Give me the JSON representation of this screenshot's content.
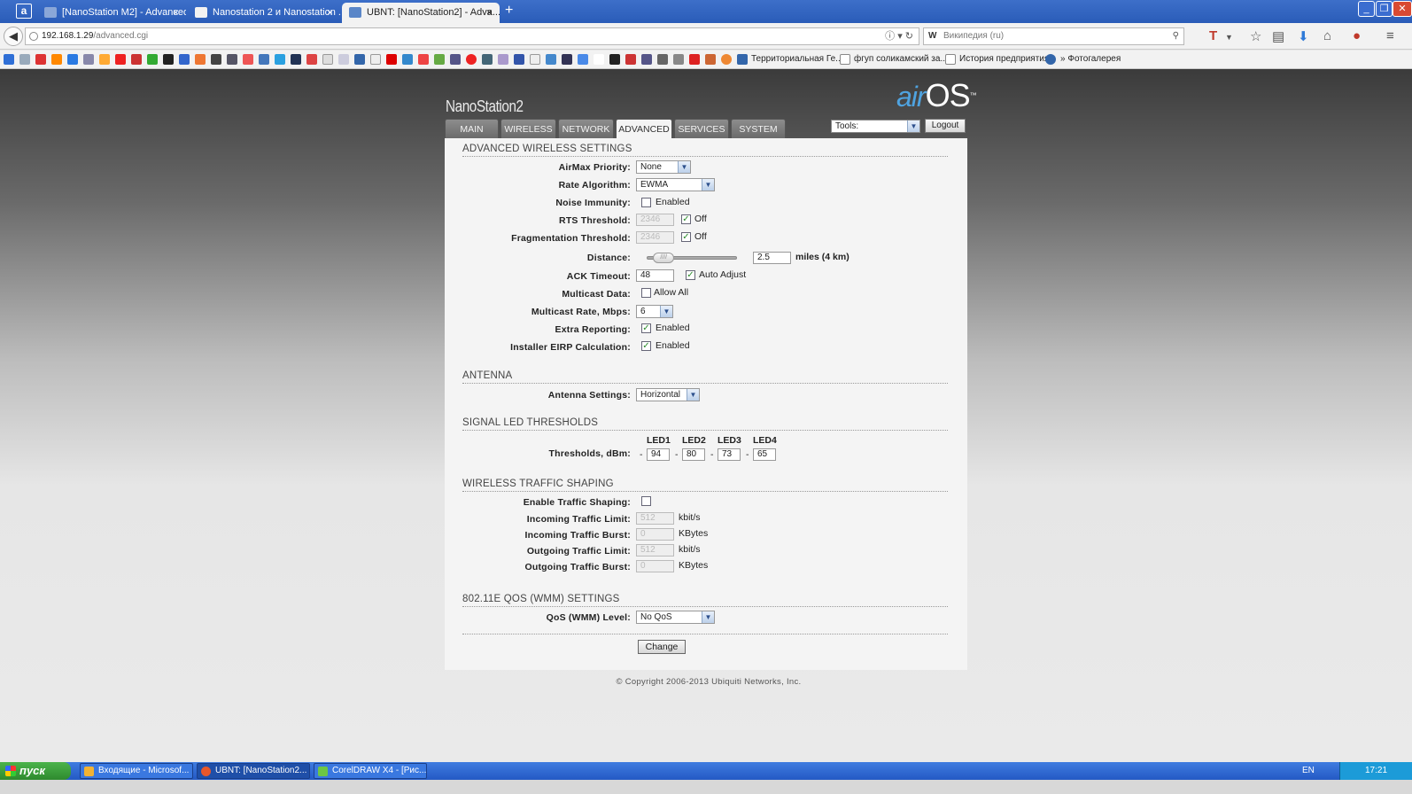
{
  "browser": {
    "tabs": [
      {
        "label": "[NanoStation M2] - Advanced",
        "close": "×"
      },
      {
        "label": "Nanostation 2 и Nanostation ...",
        "close": "×"
      },
      {
        "label": "UBNT: [NanoStation2] - Adva...",
        "close": "×"
      }
    ],
    "new_tab": "+",
    "window_controls": {
      "minimize": "_",
      "maximize": "❐",
      "close": "✕"
    },
    "url_host": "192.168.1.29",
    "url_path": "/advanced.cgi",
    "search_engine": "W",
    "search_placeholder": "Википедия (ru)",
    "bookmarks": [
      "Территориальная Ге...",
      "фгуп соликамский за...",
      "История предприятия",
      "» Фотогалерея"
    ]
  },
  "header": {
    "device_name": "NanoStation2",
    "logo_air": "air",
    "logo_os": "OS",
    "logo_tm": "™",
    "tabs": [
      "MAIN",
      "WIRELESS",
      "NETWORK",
      "ADVANCED",
      "SERVICES",
      "SYSTEM"
    ],
    "active_tab": "ADVANCED",
    "tools_select": "Tools:",
    "logout": "Logout"
  },
  "advanced_wireless": {
    "section_title": "ADVANCED WIRELESS SETTINGS",
    "airmax_priority": {
      "label": "AirMax Priority:",
      "value": "None"
    },
    "rate_algorithm": {
      "label": "Rate Algorithm:",
      "value": "EWMA"
    },
    "noise_immunity": {
      "label": "Noise Immunity:",
      "checkbox_label": "Enabled",
      "checked": false
    },
    "rts_threshold": {
      "label": "RTS Threshold:",
      "value": "2346",
      "off_label": "Off",
      "off_checked": true
    },
    "frag_threshold": {
      "label": "Fragmentation Threshold:",
      "value": "2346",
      "off_label": "Off",
      "off_checked": true
    },
    "distance": {
      "label": "Distance:",
      "value": "2.5",
      "unit_text": "miles (4 km)",
      "slider_fraction": 0.08
    },
    "ack_timeout": {
      "label": "ACK Timeout:",
      "value": "48",
      "auto_label": "Auto Adjust",
      "auto_checked": true
    },
    "multicast_data": {
      "label": "Multicast Data:",
      "checkbox_label": "Allow All",
      "checked": false
    },
    "multicast_rate": {
      "label": "Multicast Rate, Mbps:",
      "value": "6"
    },
    "extra_reporting": {
      "label": "Extra Reporting:",
      "checkbox_label": "Enabled",
      "checked": true
    },
    "installer_eirp": {
      "label": "Installer EIRP Calculation:",
      "checkbox_label": "Enabled",
      "checked": true
    }
  },
  "antenna": {
    "section_title": "ANTENNA",
    "label": "Antenna Settings:",
    "value": "Horizontal"
  },
  "signal_led": {
    "section_title": "SIGNAL LED THRESHOLDS",
    "label": "Thresholds, dBm:",
    "prefix": "-",
    "leds": [
      {
        "name": "LED1",
        "value": "94"
      },
      {
        "name": "LED2",
        "value": "80"
      },
      {
        "name": "LED3",
        "value": "73"
      },
      {
        "name": "LED4",
        "value": "65"
      }
    ]
  },
  "traffic_shaping": {
    "section_title": "WIRELESS TRAFFIC SHAPING",
    "enable": {
      "label": "Enable Traffic Shaping:",
      "checked": false
    },
    "incoming_limit": {
      "label": "Incoming Traffic Limit:",
      "value": "512",
      "unit": "kbit/s"
    },
    "incoming_burst": {
      "label": "Incoming Traffic Burst:",
      "value": "0",
      "unit": "KBytes"
    },
    "outgoing_limit": {
      "label": "Outgoing Traffic Limit:",
      "value": "512",
      "unit": "kbit/s"
    },
    "outgoing_burst": {
      "label": "Outgoing Traffic Burst:",
      "value": "0",
      "unit": "KBytes"
    }
  },
  "qos": {
    "section_title": "802.11E QOS (WMM) SETTINGS",
    "label": "QoS (WMM) Level:",
    "value": "No QoS"
  },
  "change_button": "Change",
  "copyright": "© Copyright 2006-2013 Ubiquiti Networks, Inc.",
  "taskbar": {
    "start": "пуск",
    "tasks": [
      "Входящие - Microsof...",
      "UBNT: [NanoStation2...",
      "CorelDRAW X4 - [Рис..."
    ],
    "lang": "EN",
    "clock": "17:21"
  },
  "colors": {
    "titlebar": "#2a5cb8",
    "logo_air": "#4fa3e0",
    "taskbar": "#2459c4",
    "start": "#2e8a2e",
    "checkmark": "#2a8a2a"
  }
}
